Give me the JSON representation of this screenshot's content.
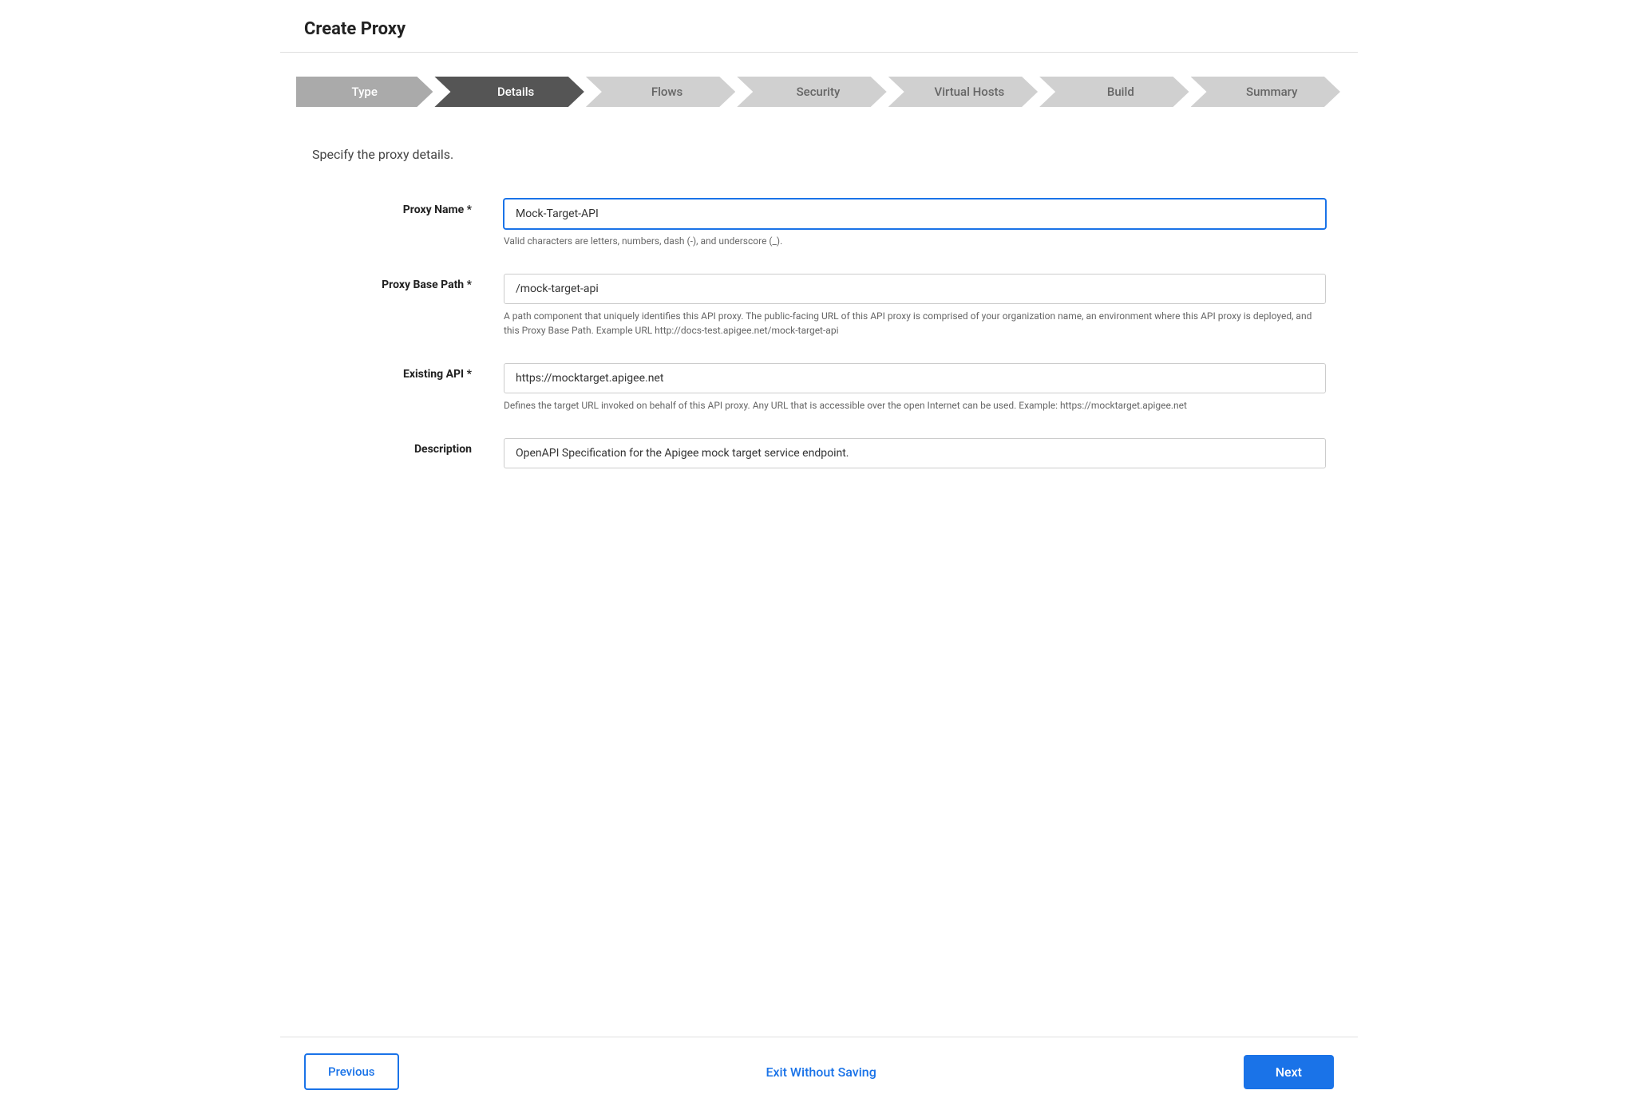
{
  "page": {
    "title": "Create Proxy"
  },
  "wizard": {
    "steps": [
      {
        "id": "type",
        "label": "Type",
        "state": "completed"
      },
      {
        "id": "details",
        "label": "Details",
        "state": "active"
      },
      {
        "id": "flows",
        "label": "Flows",
        "state": "inactive"
      },
      {
        "id": "security",
        "label": "Security",
        "state": "inactive"
      },
      {
        "id": "virtual-hosts",
        "label": "Virtual Hosts",
        "state": "inactive"
      },
      {
        "id": "build",
        "label": "Build",
        "state": "inactive"
      },
      {
        "id": "summary",
        "label": "Summary",
        "state": "inactive"
      }
    ]
  },
  "form": {
    "subtitle": "Specify the proxy details.",
    "fields": {
      "proxy_name": {
        "label": "Proxy Name *",
        "value": "Mock-Target-API",
        "hint": "Valid characters are letters, numbers, dash (-), and underscore (_)."
      },
      "proxy_base_path": {
        "label": "Proxy Base Path *",
        "value": "/mock-target-api",
        "hint": "A path component that uniquely identifies this API proxy. The public-facing URL of this API proxy is comprised of your organization name, an environment where this API proxy is deployed, and this Proxy Base Path. Example URL http://docs-test.apigee.net/mock-target-api"
      },
      "existing_api": {
        "label": "Existing API *",
        "value": "https://mocktarget.apigee.net",
        "hint": "Defines the target URL invoked on behalf of this API proxy. Any URL that is accessible over the open Internet can be used. Example: https://mocktarget.apigee.net"
      },
      "description": {
        "label": "Description",
        "value": "OpenAPI Specification for the Apigee mock target service endpoint.",
        "hint": ""
      }
    }
  },
  "footer": {
    "previous_label": "Previous",
    "exit_label": "Exit Without Saving",
    "next_label": "Next"
  }
}
